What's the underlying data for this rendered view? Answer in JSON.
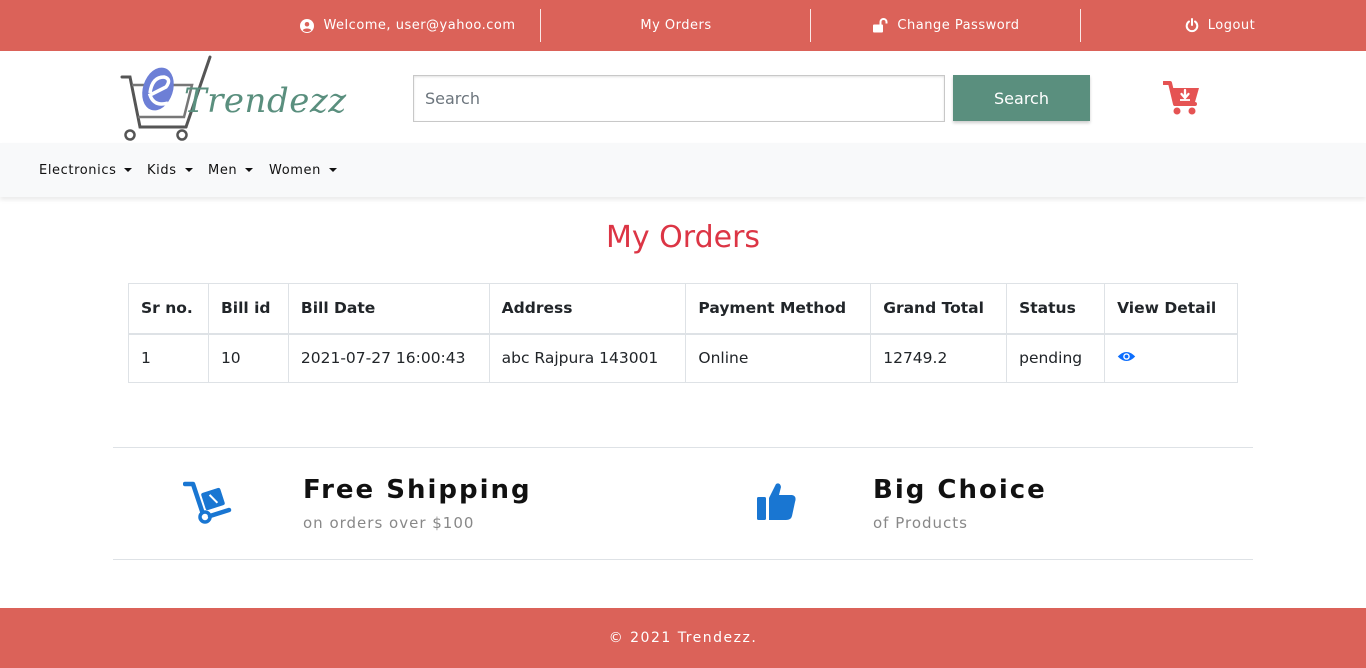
{
  "topbar": {
    "welcome": "Welcome, user@yahoo.com",
    "my_orders": "My Orders",
    "change_password": "Change Password",
    "logout": "Logout",
    "background": "#db6259"
  },
  "header": {
    "logo_text": "Trendezz",
    "search_placeholder": "Search",
    "search_button": "Search",
    "accent": "#5a8f7e",
    "cart_color": "#e55353"
  },
  "nav": {
    "items": [
      "Electronics",
      "Kids",
      "Men",
      "Women"
    ]
  },
  "main": {
    "title": "My Orders",
    "title_color": "#dc3545",
    "columns": [
      "Sr no.",
      "Bill id",
      "Bill Date",
      "Address",
      "Payment Method",
      "Grand Total",
      "Status",
      "View Detail"
    ],
    "rows": [
      {
        "sr_no": "1",
        "bill_id": "10",
        "bill_date": "2021-07-27 16:00:43",
        "address": "abc Rajpura 143001",
        "payment_method": "Online",
        "grand_total": "12749.2",
        "status": "pending",
        "view_icon": "eye-icon"
      }
    ]
  },
  "features": [
    {
      "icon": "hand-truck-icon",
      "title": "Free Shipping",
      "subtitle": "on orders over $100"
    },
    {
      "icon": "thumbs-up-icon",
      "title": "Big Choice",
      "subtitle": "of Products"
    }
  ],
  "footer": {
    "text": "© 2021 Trendezz."
  }
}
